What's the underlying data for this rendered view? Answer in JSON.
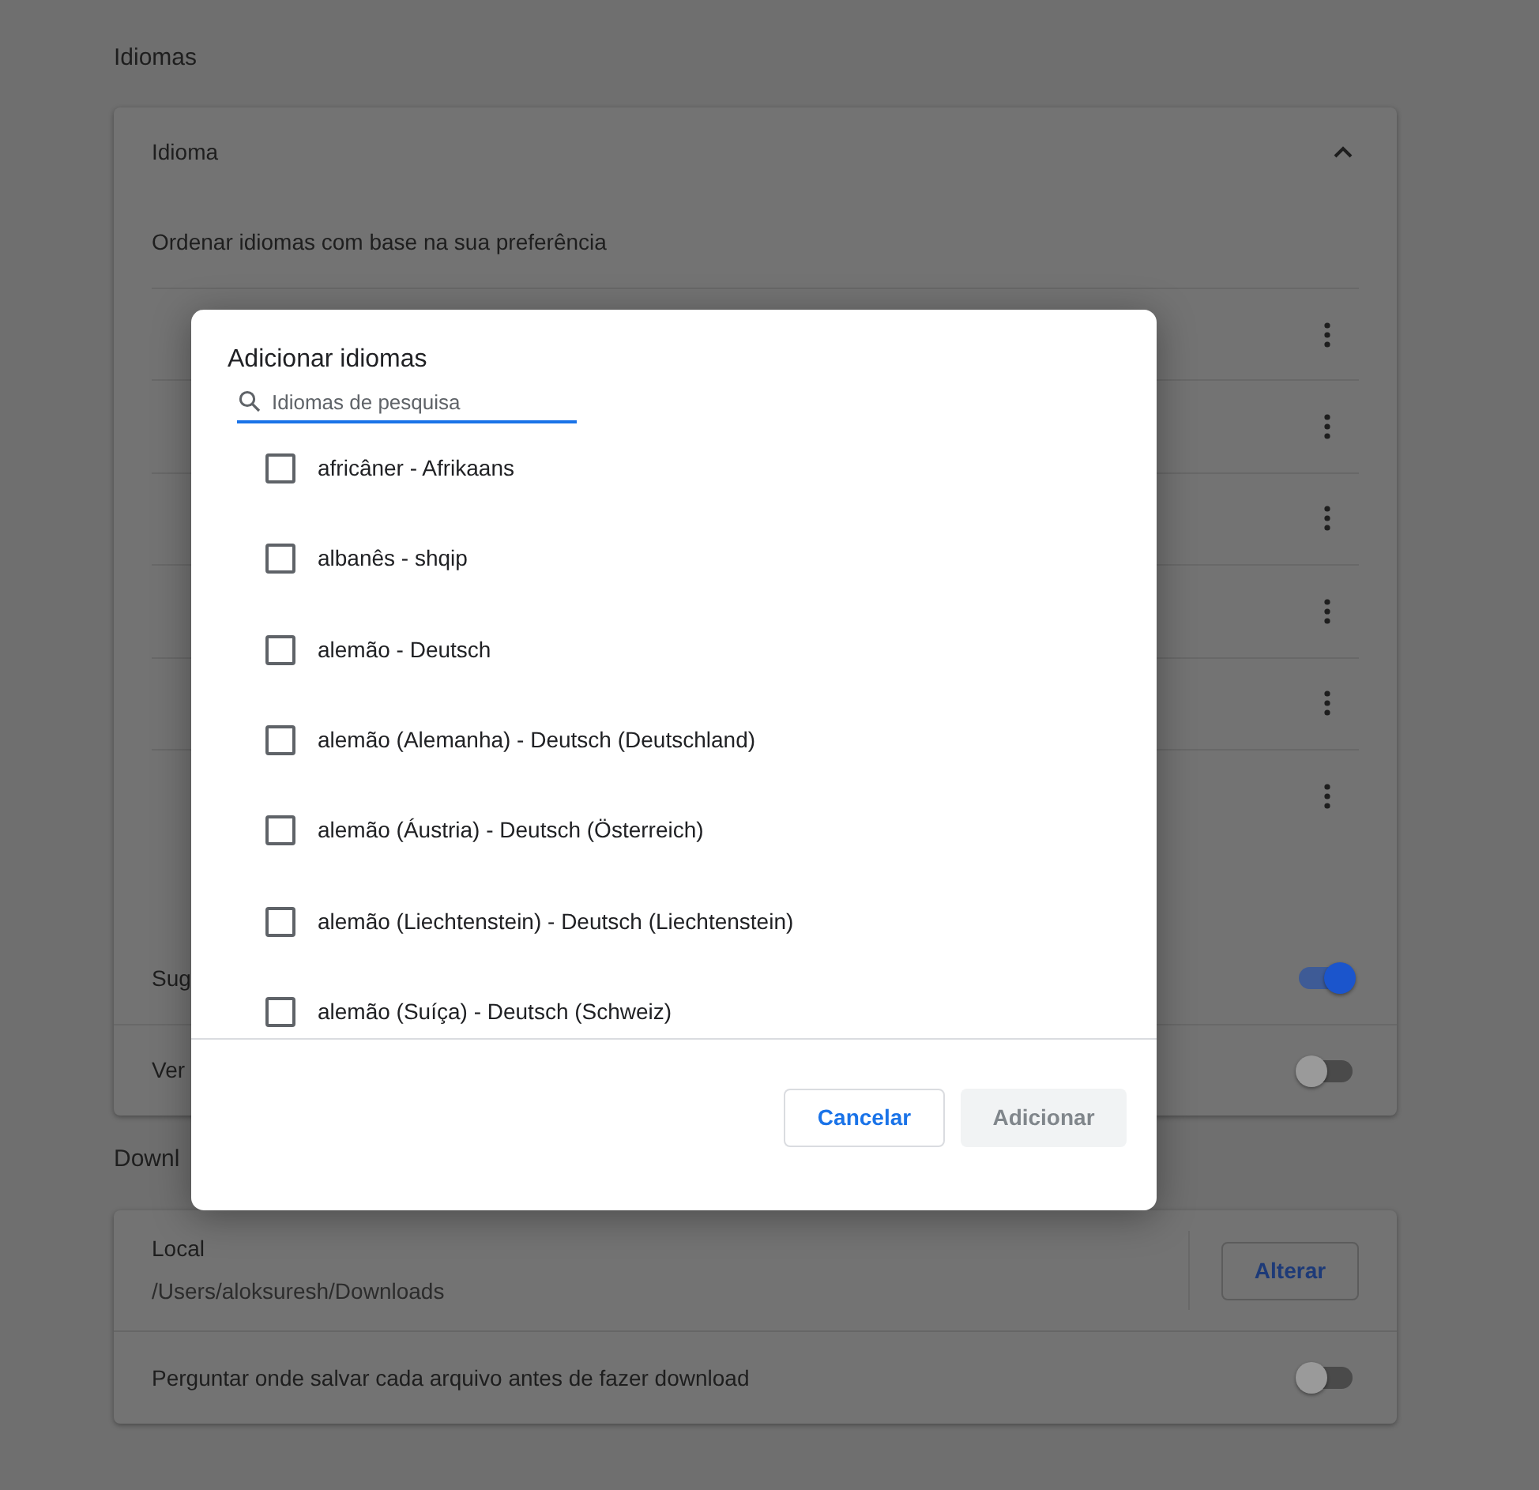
{
  "languages_section": {
    "title": "Idiomas",
    "card": {
      "header": "Idioma",
      "expanded": true,
      "order_label": "Ordenar idiomas com base na sua preferência",
      "settings": [
        {
          "label": "Sug",
          "on": true
        },
        {
          "label": "Ver",
          "on": false
        }
      ]
    }
  },
  "downloads_section": {
    "title": "Downl",
    "location_label": "Local",
    "location_path": "/Users/aloksuresh/Downloads",
    "change_button": "Alterar",
    "settings": [
      {
        "label": "Perguntar onde salvar cada arquivo antes de fazer download",
        "on": false
      }
    ]
  },
  "dialog": {
    "title": "Adicionar idiomas",
    "search": {
      "placeholder": "Idiomas de pesquisa"
    },
    "languages": [
      {
        "label": "africâner - Afrikaans",
        "checked": false
      },
      {
        "label": "albanês - shqip",
        "checked": false
      },
      {
        "label": "alemão - Deutsch",
        "checked": false
      },
      {
        "label": "alemão (Alemanha) - Deutsch (Deutschland)",
        "checked": false
      },
      {
        "label": "alemão (Áustria) - Deutsch (Österreich)",
        "checked": false
      },
      {
        "label": "alemão (Liechtenstein) - Deutsch (Liechtenstein)",
        "checked": false
      },
      {
        "label": "alemão (Suíça) - Deutsch (Schweiz)",
        "checked": false
      }
    ],
    "buttons": [
      {
        "label": "Cancelar",
        "kind": "secondary",
        "disabled": false
      },
      {
        "label": "Adicionar",
        "kind": "primary",
        "disabled": true
      }
    ]
  }
}
